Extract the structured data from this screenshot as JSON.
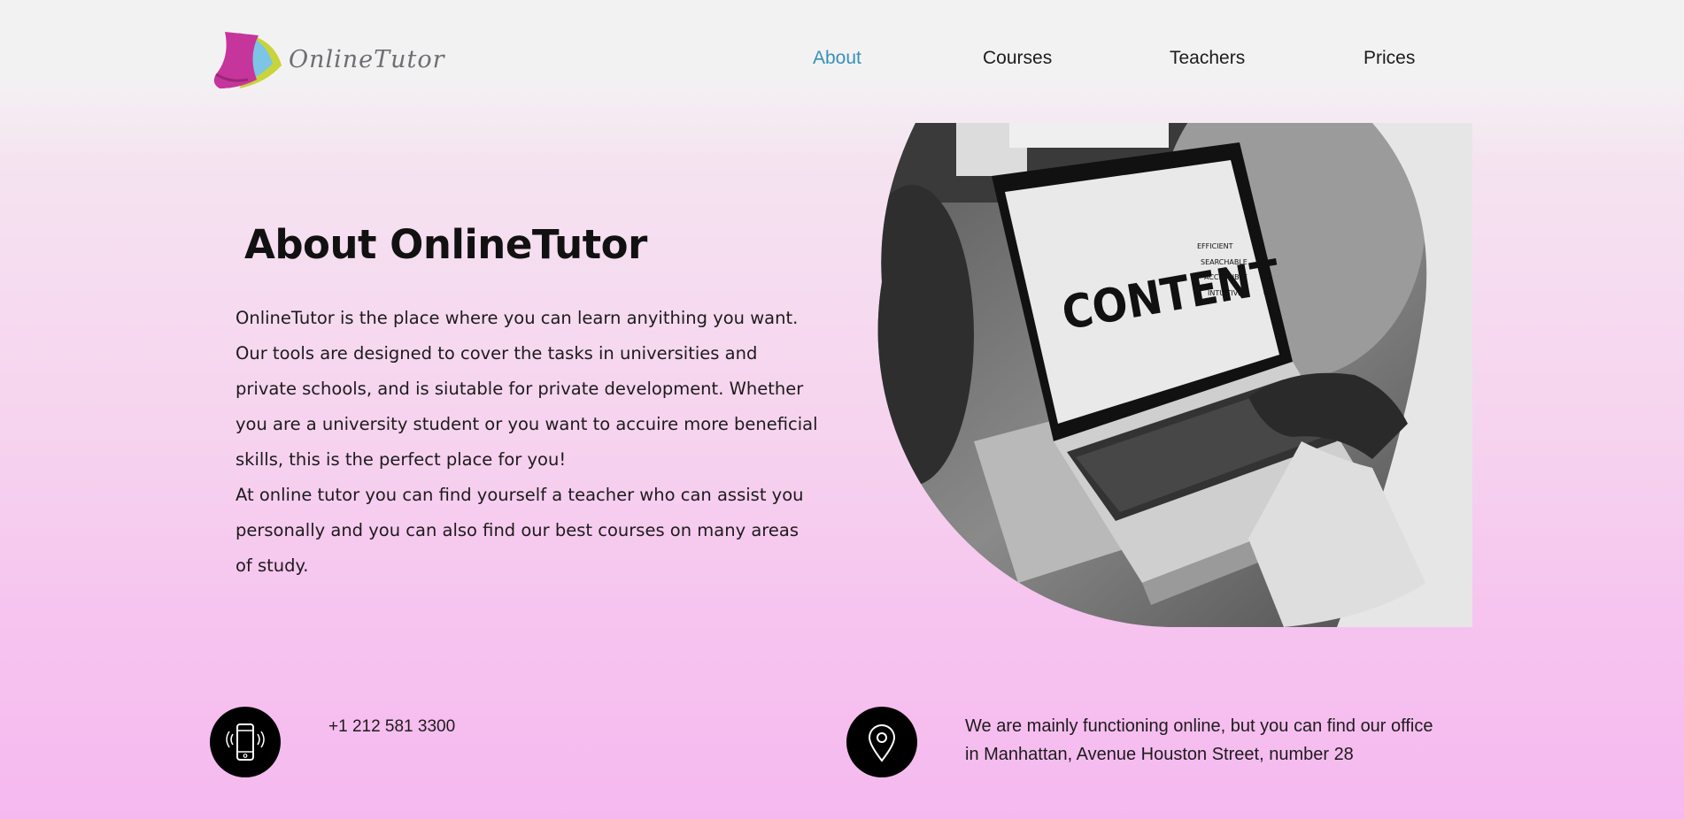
{
  "brand": {
    "logo_text": "OnlineTutor"
  },
  "nav": {
    "items": [
      {
        "label": "About",
        "active": true
      },
      {
        "label": "Courses",
        "active": false
      },
      {
        "label": "Teachers",
        "active": false
      },
      {
        "label": "Prices",
        "active": false
      }
    ],
    "active_color": "#3791b9"
  },
  "main": {
    "title": "About OnlineTutor",
    "paragraph_1": "OnlineTutor is the place where you can learn anyithing you want. Our tools are designed to cover the  tasks in universities and private schools, and is siutable for private development. Whether you are a university student or you want to accuire more beneficial skills, this is the perfect place for you!",
    "paragraph_2": "At online tutor you can find yourself a teacher who can assist you personally and you can also find our best courses on many areas of study."
  },
  "hero_image": {
    "screen_headline": "CONTENT",
    "screen_tags": [
      "EFFICIENT",
      "SEARCHABLE",
      "ACCESSIBLE",
      "INTUITIVE"
    ]
  },
  "contact": {
    "phone": "+1 212 581 3300",
    "phone_icon": "smartphone-icon",
    "address_icon": "location-pin-icon",
    "address_line_1": "We are mainly functioning online, but you can find our office",
    "address_line_2": "in Manhattan, Avenue Houston Street, number 28"
  },
  "colors": {
    "background_top": "#f3f2f3",
    "background_bottom": "#f5b9ef",
    "text": "#1d1b1c"
  }
}
